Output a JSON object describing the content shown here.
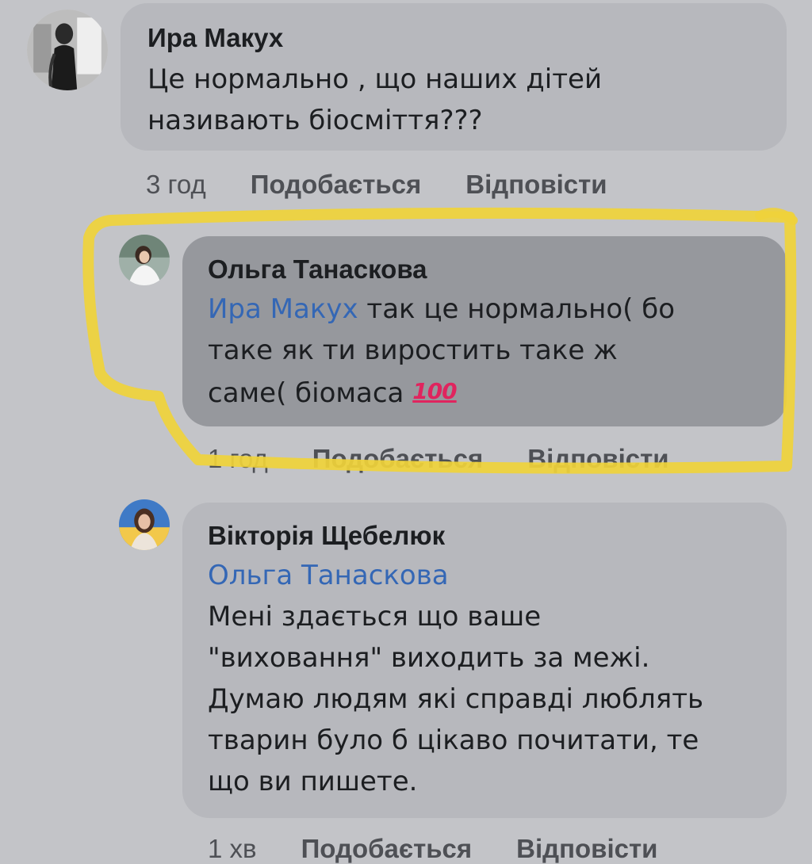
{
  "comments": [
    {
      "author": "Ира Макух",
      "text_lines": [
        "Це нормально , що наших дітей",
        "називають біосміття???"
      ],
      "time": "3 год",
      "like_label": "Подобається",
      "reply_label": "Відповісти"
    },
    {
      "author": "Ольга Танаскова",
      "mention": "Ира Макух",
      "text_lines": [
        " так це нормально( бо",
        "таке як ти виростить таке ж",
        "саме( біомаса"
      ],
      "emoji": "100",
      "time": "1 год",
      "like_label": "Подобається",
      "reply_label": "Відповісти"
    },
    {
      "author": "Вікторія Щебелюк",
      "mention": "Ольга Танаскова",
      "text_lines": [
        "Мені здається що ваше",
        "\"виховання\" виходить за межі.",
        "Думаю людям які справді люблять",
        "тварин було б цікаво почитати, те",
        "що ви пишете."
      ],
      "time": "1 хв",
      "like_label": "Подобається",
      "reply_label": "Відповісти"
    }
  ],
  "colors": {
    "background": "#c3c4c8",
    "bubble": "#b7b8bd",
    "highlighted_bubble": "#96989d",
    "mention": "#3467b5",
    "highlight_marker": "#f0d23a"
  }
}
